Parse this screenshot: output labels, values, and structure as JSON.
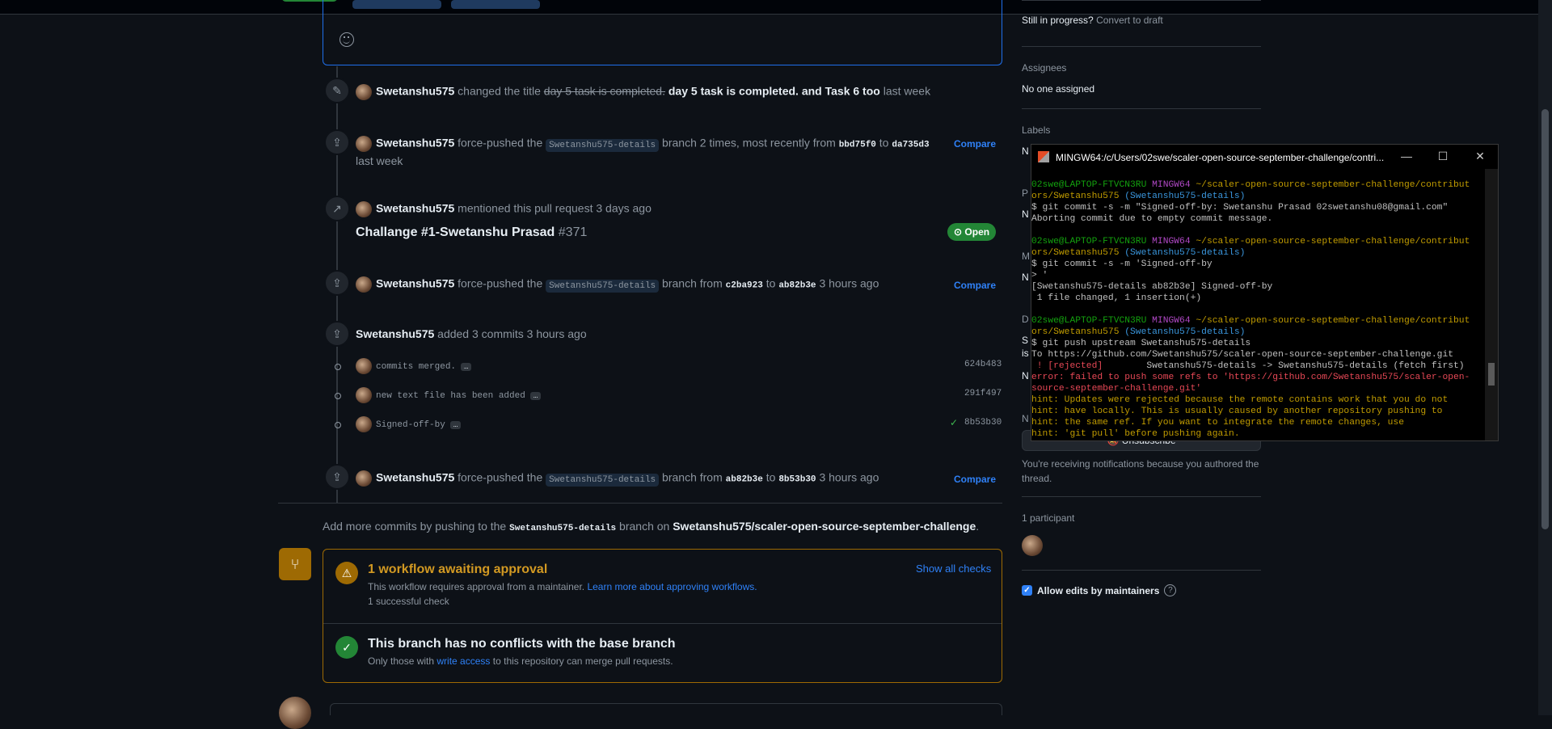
{
  "colors": {
    "bg": "#0d1117",
    "accent": "#2f81f7",
    "green": "#238636",
    "warn": "#9e6a03",
    "terminal_bg": "#000000"
  },
  "timeline": {
    "title_change": {
      "user": "Swetanshu575",
      "action": "changed the title",
      "old_title": "day 5 task is completed.",
      "new_title": "day 5 task is completed. and Task 6 too",
      "time": "last week"
    },
    "force_push_1": {
      "user": "Swetanshu575",
      "action_a": "force-pushed the",
      "branch": "Swetanshu575-details",
      "action_b": "branch 2 times, most recently from",
      "from": "bbd75f0",
      "to_word": "to",
      "to": "da735d3",
      "time": "last week",
      "compare": "Compare"
    },
    "mention": {
      "user": "Swetanshu575",
      "action": "mentioned this pull request",
      "time": "3 days ago",
      "pr_title": "Challange #1-Swetanshu Prasad",
      "pr_number": "#371",
      "status": "Open"
    },
    "force_push_2": {
      "user": "Swetanshu575",
      "action_a": "force-pushed the",
      "branch": "Swetanshu575-details",
      "action_b": "branch from",
      "from": "c2ba923",
      "to_word": "to",
      "to": "ab82b3e",
      "time": "3 hours ago",
      "compare": "Compare"
    },
    "commits_added": {
      "user": "Swetanshu575",
      "action": "added 3 commits",
      "time": "3 hours ago"
    },
    "commits": [
      {
        "message": "commits merged.",
        "hash": "624b483",
        "check": false
      },
      {
        "message": "new text file has been added",
        "hash": "291f497",
        "check": false
      },
      {
        "message": "Signed-off-by",
        "hash": "8b53b30",
        "check": true
      }
    ],
    "force_push_3": {
      "user": "Swetanshu575",
      "action_a": "force-pushed the",
      "branch": "Swetanshu575-details",
      "action_b": "branch from",
      "from": "ab82b3e",
      "to_word": "to",
      "to": "8b53b30",
      "time": "3 hours ago",
      "compare": "Compare"
    }
  },
  "push_hint": {
    "prefix": "Add more commits by pushing to the",
    "branch": "Swetanshu575-details",
    "middle": "branch on",
    "repo": "Swetanshu575/scaler-open-source-september-challenge",
    "suffix": "."
  },
  "merge": {
    "workflow_title": "1 workflow awaiting approval",
    "workflow_desc": "This workflow requires approval from a maintainer.",
    "workflow_link": "Learn more about approving workflows.",
    "successful": "1 successful check",
    "show_all": "Show all checks",
    "conflict_title": "This branch has no conflicts with the base branch",
    "conflict_prefix": "Only those with",
    "conflict_link": "write access",
    "conflict_suffix": "to this repository can merge pull requests."
  },
  "sidebar": {
    "in_progress": "Still in progress?",
    "convert": "Convert to draft",
    "assignees_h": "Assignees",
    "assignees_v": "No one assigned",
    "labels_h": "Labels",
    "labels_v": "N",
    "p_h": "P",
    "p_v": "N",
    "m_h": "M",
    "m_v": "N",
    "d_h": "D",
    "d_v1": "S",
    "d_v2": "is",
    "d_v3": "N",
    "n_h": "N",
    "unsubscribe": "Unsubscribe",
    "notif": "You're receiving notifications because you authored the thread.",
    "participants_h": "1 participant",
    "allow_edits": "Allow edits by maintainers"
  },
  "terminal": {
    "title": "MINGW64:/c/Users/02swe/scaler-open-source-september-challenge/contri...",
    "lines": [
      [
        {
          "c": "cg",
          "t": "02swe@LAPTOP-FTVCN3RU "
        },
        {
          "c": "cm",
          "t": "MINGW64 "
        },
        {
          "c": "cy",
          "t": "~/scaler-open-source-september-challenge/contribut"
        }
      ],
      [
        {
          "c": "cy",
          "t": "ors/Swetanshu575 "
        },
        {
          "c": "cc",
          "t": "(Swetanshu575-details)"
        }
      ],
      [
        {
          "c": "cw",
          "t": "$ git commit -s -m \"Signed-off-by: Swetanshu Prasad 02swetanshu08@gmail.com\""
        }
      ],
      [
        {
          "c": "cw",
          "t": "Aborting commit due to empty commit message."
        }
      ],
      [
        {
          "c": "cw",
          "t": ""
        }
      ],
      [
        {
          "c": "cg",
          "t": "02swe@LAPTOP-FTVCN3RU "
        },
        {
          "c": "cm",
          "t": "MINGW64 "
        },
        {
          "c": "cy",
          "t": "~/scaler-open-source-september-challenge/contribut"
        }
      ],
      [
        {
          "c": "cy",
          "t": "ors/Swetanshu575 "
        },
        {
          "c": "cc",
          "t": "(Swetanshu575-details)"
        }
      ],
      [
        {
          "c": "cw",
          "t": "$ git commit -s -m 'Signed-off-by"
        }
      ],
      [
        {
          "c": "cw",
          "t": "> '"
        }
      ],
      [
        {
          "c": "cw",
          "t": "[Swetanshu575-details ab82b3e] Signed-off-by"
        }
      ],
      [
        {
          "c": "cw",
          "t": " 1 file changed, 1 insertion(+)"
        }
      ],
      [
        {
          "c": "cw",
          "t": ""
        }
      ],
      [
        {
          "c": "cg",
          "t": "02swe@LAPTOP-FTVCN3RU "
        },
        {
          "c": "cm",
          "t": "MINGW64 "
        },
        {
          "c": "cy",
          "t": "~/scaler-open-source-september-challenge/contribut"
        }
      ],
      [
        {
          "c": "cy",
          "t": "ors/Swetanshu575 "
        },
        {
          "c": "cc",
          "t": "(Swetanshu575-details)"
        }
      ],
      [
        {
          "c": "cw",
          "t": "$ git push upstream Swetanshu575-details"
        }
      ],
      [
        {
          "c": "cw",
          "t": "To https://github.com/Swetanshu575/scaler-open-source-september-challenge.git"
        }
      ],
      [
        {
          "c": "cr",
          "t": " ! [rejected]        "
        },
        {
          "c": "cw",
          "t": "Swetanshu575-details -> Swetanshu575-details (fetch first)"
        }
      ],
      [
        {
          "c": "cr",
          "t": "error: failed to push some refs to 'https://github.com/Swetanshu575/scaler-open-"
        }
      ],
      [
        {
          "c": "cr",
          "t": "source-september-challenge.git'"
        }
      ],
      [
        {
          "c": "cy",
          "t": "hint: Updates were rejected because the remote contains work that you do not"
        }
      ],
      [
        {
          "c": "cy",
          "t": "hint: have locally. This is usually caused by another repository pushing to"
        }
      ],
      [
        {
          "c": "cy",
          "t": "hint: the same ref. If you want to integrate the remote changes, use"
        }
      ],
      [
        {
          "c": "cy",
          "t": "hint: 'git pull' before pushing again."
        }
      ]
    ]
  }
}
